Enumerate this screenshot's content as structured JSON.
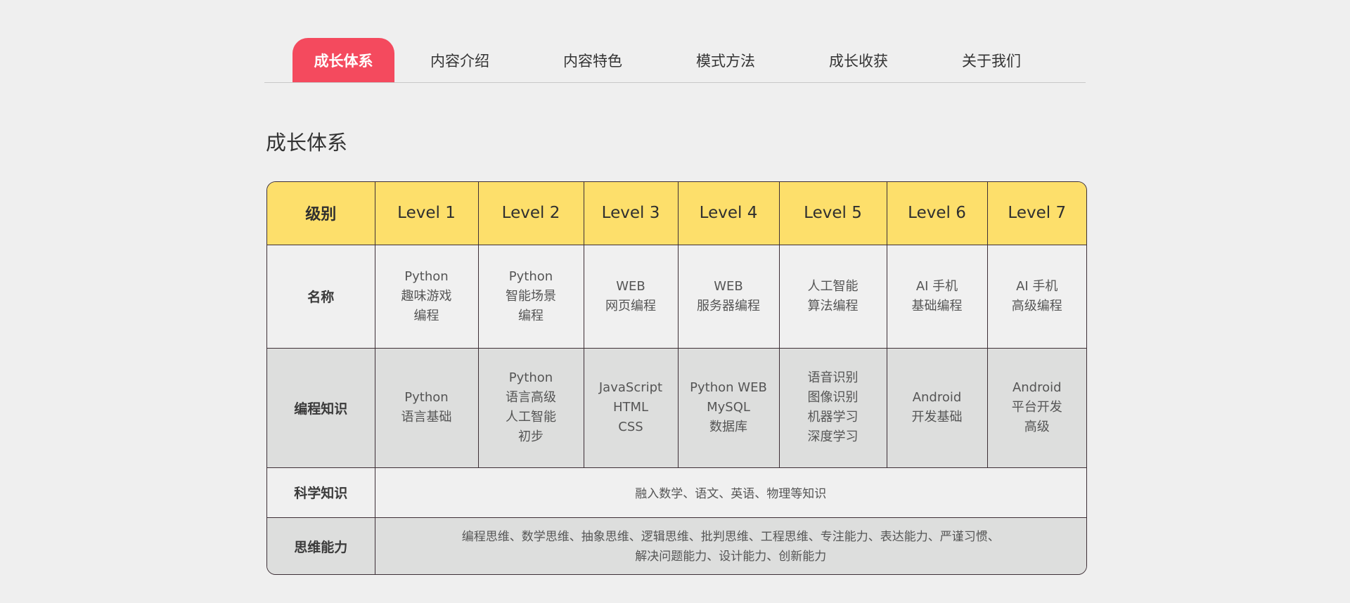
{
  "tabs": [
    {
      "label": "成长体系",
      "active": true
    },
    {
      "label": "内容介绍",
      "active": false
    },
    {
      "label": "内容特色",
      "active": false
    },
    {
      "label": "模式方法",
      "active": false
    },
    {
      "label": "成长收获",
      "active": false
    },
    {
      "label": "关于我们",
      "active": false
    }
  ],
  "section_title": "成长体系",
  "table": {
    "corner_label": "级别",
    "levels": [
      "Level 1",
      "Level 2",
      "Level 3",
      "Level 4",
      "Level 5",
      "Level 6",
      "Level 7"
    ],
    "rows": {
      "name": {
        "label": "名称",
        "cells": [
          [
            "Python",
            "趣味游戏",
            "编程"
          ],
          [
            "Python",
            "智能场景",
            "编程"
          ],
          [
            "WEB",
            "网页编程"
          ],
          [
            "WEB",
            "服务器编程"
          ],
          [
            "人工智能",
            "算法编程"
          ],
          [
            "AI 手机",
            "基础编程"
          ],
          [
            "AI 手机",
            "高级编程"
          ]
        ]
      },
      "coding": {
        "label": "编程知识",
        "cells": [
          [
            "Python",
            "语言基础"
          ],
          [
            "Python",
            "语言高级",
            "人工智能",
            "初步"
          ],
          [
            "JavaScript",
            "HTML",
            "CSS"
          ],
          [
            "Python WEB",
            "MySQL",
            "数据库"
          ],
          [
            "语音识别",
            "图像识别",
            "机器学习",
            "深度学习"
          ],
          [
            "Android",
            "开发基础"
          ],
          [
            "Android",
            "平台开发",
            "高级"
          ]
        ]
      },
      "science": {
        "label": "科学知识",
        "text": "融入数学、语文、英语、物理等知识"
      },
      "thinking": {
        "label": "思维能力",
        "lines": [
          "编程思维、数学思维、抽象思维、逻辑思维、批判思维、工程思维、专注能力、表达能力、严谨习惯、",
          "解决问题能力、设计能力、创新能力"
        ]
      }
    }
  },
  "colors": {
    "active_tab": "#f44a5e",
    "header_row": "#fddf6b",
    "band_light": "#f0f0f0",
    "band_dark": "#dddedd",
    "border": "#3d2f36",
    "page_bg": "#efefef"
  }
}
